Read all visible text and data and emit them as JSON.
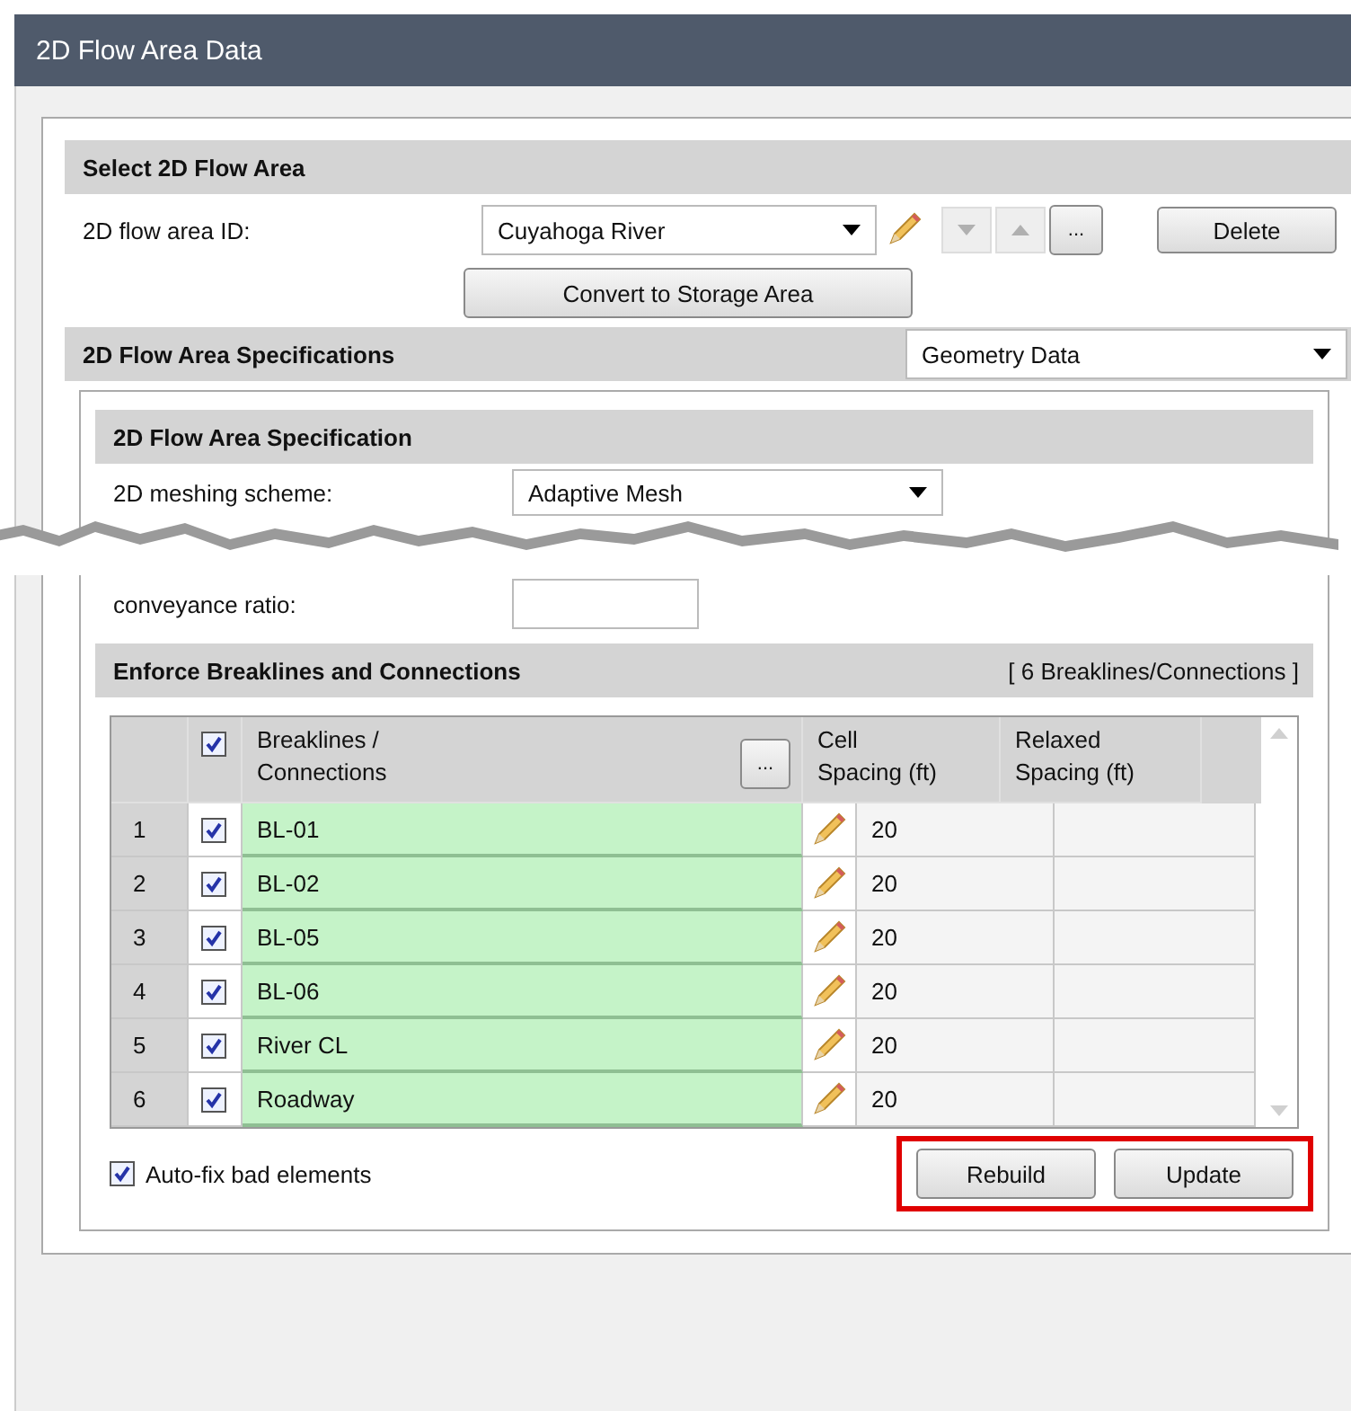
{
  "window": {
    "title": "2D Flow Area Data"
  },
  "select_area": {
    "title": "Select 2D Flow Area",
    "id_label": "2D flow area ID:",
    "id_value": "Cuyahoga River",
    "nav_buttons": [
      {
        "kind": "down",
        "disabled": true
      },
      {
        "kind": "up",
        "disabled": true
      }
    ],
    "more_button": "...",
    "delete_button": "Delete",
    "convert_button": "Convert to Storage Area"
  },
  "specifications": {
    "title": "2D Flow Area Specifications",
    "source": "Geometry Data"
  },
  "specification": {
    "title": "2D Flow Area Specification",
    "fields": [
      {
        "kind": "dropdown",
        "label": "2D meshing scheme:",
        "value": "Adaptive Mesh"
      },
      {
        "kind": "text",
        "label": "conveyance ratio:"
      }
    ]
  },
  "breaklines": {
    "title": "Enforce Breaklines and Connections",
    "count": "[ 6 Breaklines/Connections ]",
    "all_checked": true,
    "columns": [
      "Breaklines /\nConnections",
      "Cell\nSpacing (ft)",
      "Relaxed\nSpacing (ft)"
    ],
    "header_button": "...",
    "rows": [
      {
        "number": "1",
        "checked": true,
        "name": "BL-01",
        "cell_spacing": "20"
      },
      {
        "number": "2",
        "checked": true,
        "name": "BL-02",
        "cell_spacing": "20"
      },
      {
        "number": "3",
        "checked": true,
        "name": "BL-05",
        "cell_spacing": "20"
      },
      {
        "number": "4",
        "checked": true,
        "name": "BL-06",
        "cell_spacing": "20"
      },
      {
        "number": "5",
        "checked": true,
        "name": "River CL",
        "cell_spacing": "20"
      },
      {
        "number": "6",
        "checked": true,
        "name": "Roadway",
        "cell_spacing": "20"
      }
    ],
    "auto_fix": {
      "label": "Auto-fix bad elements",
      "checked": true
    },
    "actions": {
      "highlighted": true,
      "buttons": [
        "Rebuild",
        "Update"
      ]
    }
  }
}
